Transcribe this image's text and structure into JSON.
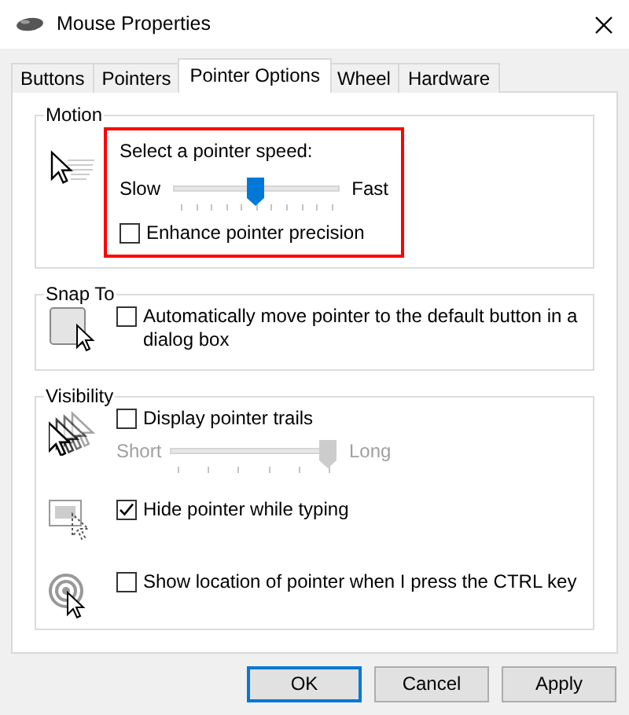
{
  "window": {
    "title": "Mouse Properties"
  },
  "tabs": [
    {
      "label": "Buttons",
      "selected": false
    },
    {
      "label": "Pointers",
      "selected": false
    },
    {
      "label": "Pointer Options",
      "selected": true
    },
    {
      "label": "Wheel",
      "selected": false
    },
    {
      "label": "Hardware",
      "selected": false
    }
  ],
  "groups": [
    {
      "title": "Motion",
      "highlighted": true,
      "blocks": [
        {
          "items": [
            {
              "kind": "text",
              "text": "Select a pointer speed:"
            },
            {
              "kind": "slider",
              "min_label": "Slow",
              "max_label": "Fast",
              "level": 0.5,
              "disabled": false
            },
            {
              "kind": "checkbox",
              "label": "Enhance pointer precision",
              "checked": false
            }
          ]
        }
      ]
    },
    {
      "title": "Snap To",
      "highlighted": false,
      "blocks": [
        {
          "items": [
            {
              "kind": "checkbox",
              "label": "Automatically move pointer to the default button in a dialog box",
              "checked": false
            }
          ]
        }
      ]
    },
    {
      "title": "Visibility",
      "highlighted": false,
      "blocks": [
        {
          "items": [
            {
              "kind": "checkbox",
              "label": "Display pointer trails",
              "checked": false
            },
            {
              "kind": "slider",
              "min_label": "Short",
              "max_label": "Long",
              "level": 1,
              "disabled": true
            }
          ]
        },
        {
          "items": [
            {
              "kind": "checkbox",
              "label": "Hide pointer while typing",
              "checked": true
            }
          ]
        },
        {
          "items": [
            {
              "kind": "checkbox",
              "label": "Show location of pointer when I press the CTRL key",
              "checked": false
            }
          ]
        }
      ]
    }
  ],
  "buttons": [
    {
      "label": "OK",
      "default": true
    },
    {
      "label": "Cancel",
      "default": false
    },
    {
      "label": "Apply",
      "default": false
    }
  ]
}
